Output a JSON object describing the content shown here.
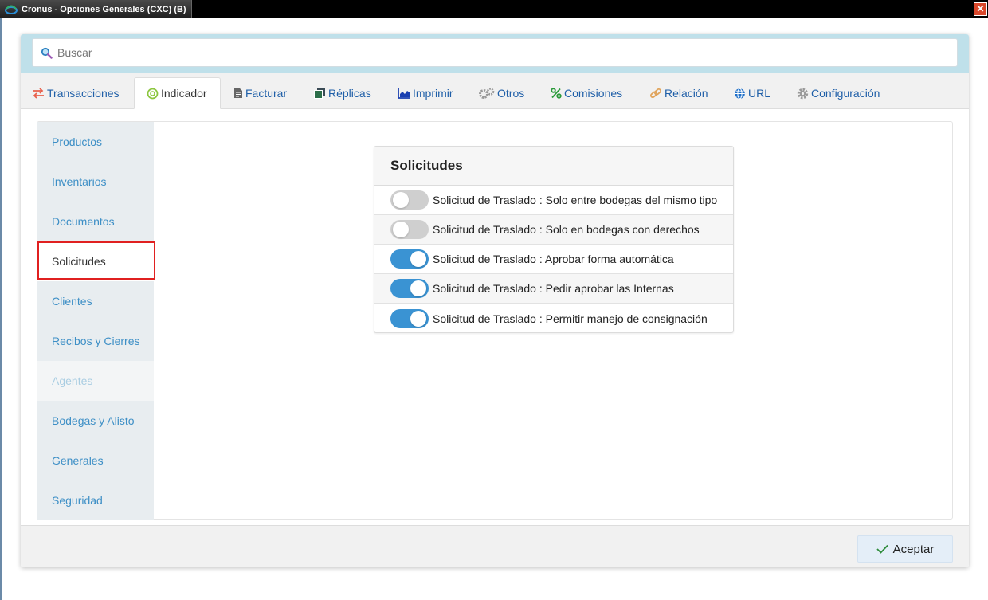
{
  "window": {
    "title": "Cronus - Opciones Generales (CXC) (B)",
    "close_label": "✕"
  },
  "search": {
    "placeholder": "Buscar"
  },
  "tabs": [
    {
      "label": "Transacciones",
      "icon": "exchange-arrows-icon"
    },
    {
      "label": "Indicador",
      "icon": "target-indicator-icon",
      "active": true
    },
    {
      "label": "Facturar",
      "icon": "invoice-document-icon"
    },
    {
      "label": "Réplicas",
      "icon": "copies-icon"
    },
    {
      "label": "Imprimir",
      "icon": "area-chart-icon"
    },
    {
      "label": "Otros",
      "icon": "gears-icon"
    },
    {
      "label": "Comisiones",
      "icon": "percent-icon"
    },
    {
      "label": "Relación",
      "icon": "link-icon"
    },
    {
      "label": "URL",
      "icon": "globe-icon"
    },
    {
      "label": "Configuración",
      "icon": "gear-icon"
    }
  ],
  "sidebar": {
    "items": [
      {
        "label": "Productos"
      },
      {
        "label": "Inventarios"
      },
      {
        "label": "Documentos"
      },
      {
        "label": "Solicitudes",
        "active": true
      },
      {
        "label": "Clientes"
      },
      {
        "label": "Recibos y Cierres"
      },
      {
        "label": "Agentes",
        "disabled": true
      },
      {
        "label": "Bodegas y Alisto"
      },
      {
        "label": "Generales"
      },
      {
        "label": "Seguridad"
      }
    ]
  },
  "panel": {
    "title": "Solicitudes",
    "options": [
      {
        "label": "Solicitud de Traslado : Solo entre bodegas del mismo tipo",
        "enabled": false
      },
      {
        "label": "Solicitud de Traslado : Solo en bodegas con derechos",
        "enabled": false
      },
      {
        "label": "Solicitud de Traslado : Aprobar forma automática",
        "enabled": true
      },
      {
        "label": "Solicitud de Traslado : Pedir aprobar las Internas",
        "enabled": true
      },
      {
        "label": "Solicitud de Traslado : Permitir manejo de consignación",
        "enabled": true
      }
    ]
  },
  "footer": {
    "accept_label": "Aceptar"
  },
  "colors": {
    "accent": "#3a93d3",
    "link": "#1f5fa8",
    "nav_text": "#3d8fc6",
    "highlight": "#e02020",
    "search_band": "#bfe0ea"
  }
}
